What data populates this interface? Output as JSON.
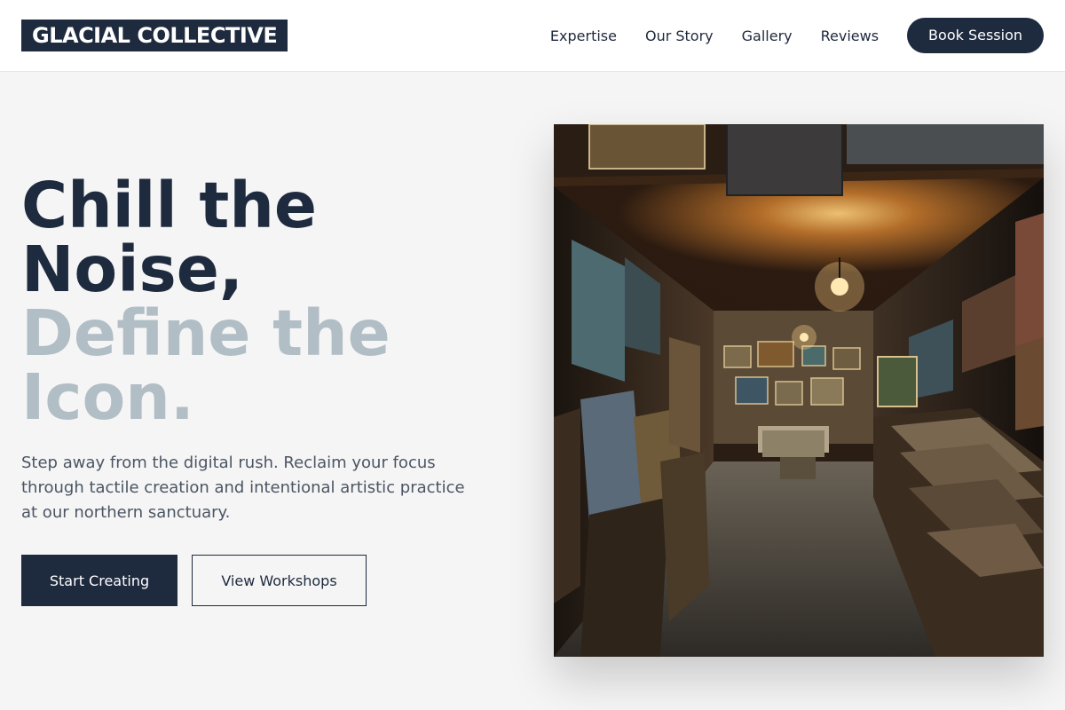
{
  "brand": {
    "logo_text": "GLACIAL COLLECTIVE"
  },
  "nav": {
    "links": [
      "Expertise",
      "Our Story",
      "Gallery",
      "Reviews"
    ],
    "cta_label": "Book Session"
  },
  "hero": {
    "title_dark": [
      "Chill the",
      "Noise,"
    ],
    "title_light": [
      "Define the",
      "Icon."
    ],
    "subtitle": "Step away from the digital rush. Reclaim your focus through tactile creation and intentional artistic practice at our northern sanctuary.",
    "primary_button": "Start Creating",
    "secondary_button": "View Workshops"
  },
  "colors": {
    "navy": "#1e2a3e",
    "muted_blue": "#b1bec5",
    "background": "#f5f5f5"
  }
}
